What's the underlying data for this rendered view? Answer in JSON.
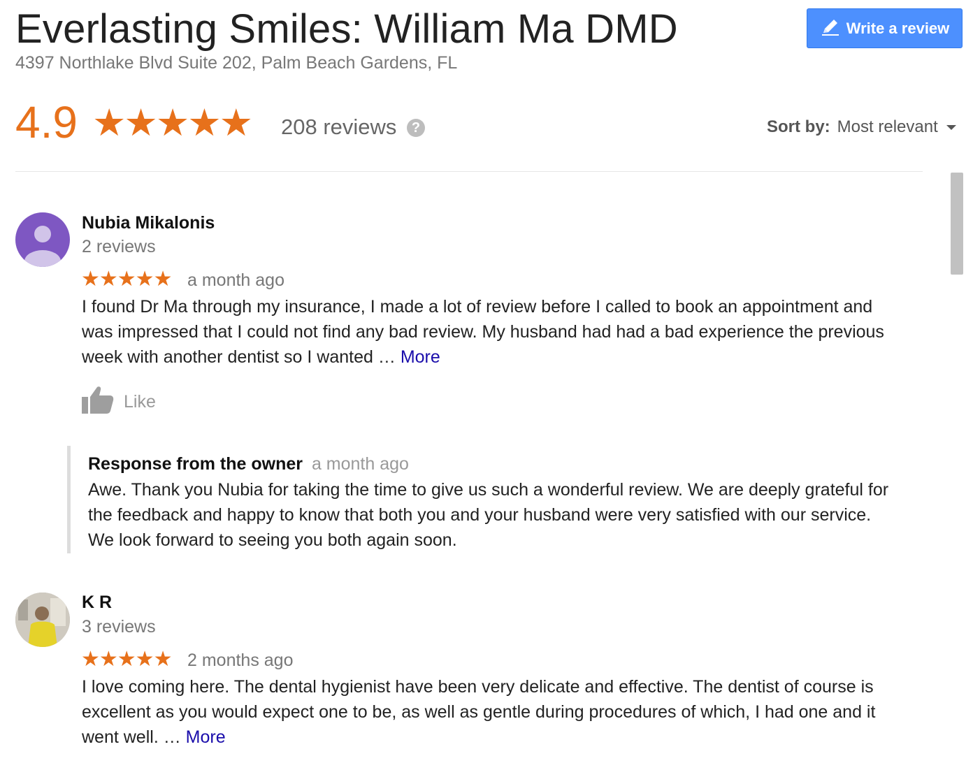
{
  "header": {
    "title": "Everlasting Smiles: William Ma DMD",
    "address": "4397 Northlake Blvd Suite 202, Palm Beach Gardens, FL",
    "write_review_label": "Write a review"
  },
  "summary": {
    "rating": "4.9",
    "stars": "★★★★★",
    "review_count": "208 reviews",
    "help_glyph": "?"
  },
  "sort": {
    "label": "Sort by:",
    "value": "Most relevant"
  },
  "colors": {
    "star": "#e7711b",
    "link": "#1a0dab",
    "button": "#4d90fe"
  },
  "reviews": [
    {
      "name": "Nubia Mikalonis",
      "meta": "2 reviews",
      "stars": "★★★★★",
      "ago": "a month ago",
      "text_lines": [
        "I found Dr Ma through my insurance, I made a lot of review before I called to book an appointment and",
        "was impressed that I could not find any bad review. My husband had had a bad experience the previous",
        "week with another dentist so I wanted … "
      ],
      "more": "More",
      "like": "Like",
      "owner_response": {
        "title": "Response from the owner",
        "ago": "a month ago",
        "text_lines": [
          "Awe. Thank you Nubia for taking the time to give us such a wonderful review. We are deeply grateful for",
          "the feedback and happy to know that both you and your husband were very satisfied with our service.",
          "We look forward to seeing you both again soon."
        ]
      }
    },
    {
      "name": "K R",
      "meta": "3 reviews",
      "stars": "★★★★★",
      "ago": "2 months ago",
      "text_lines": [
        "I love coming here. The dental hygienist have been very delicate and effective. The dentist of course is",
        "excellent as you would expect one to be, as well as gentle during procedures of which, I had one and it",
        "went well. … "
      ],
      "more": "More"
    }
  ]
}
